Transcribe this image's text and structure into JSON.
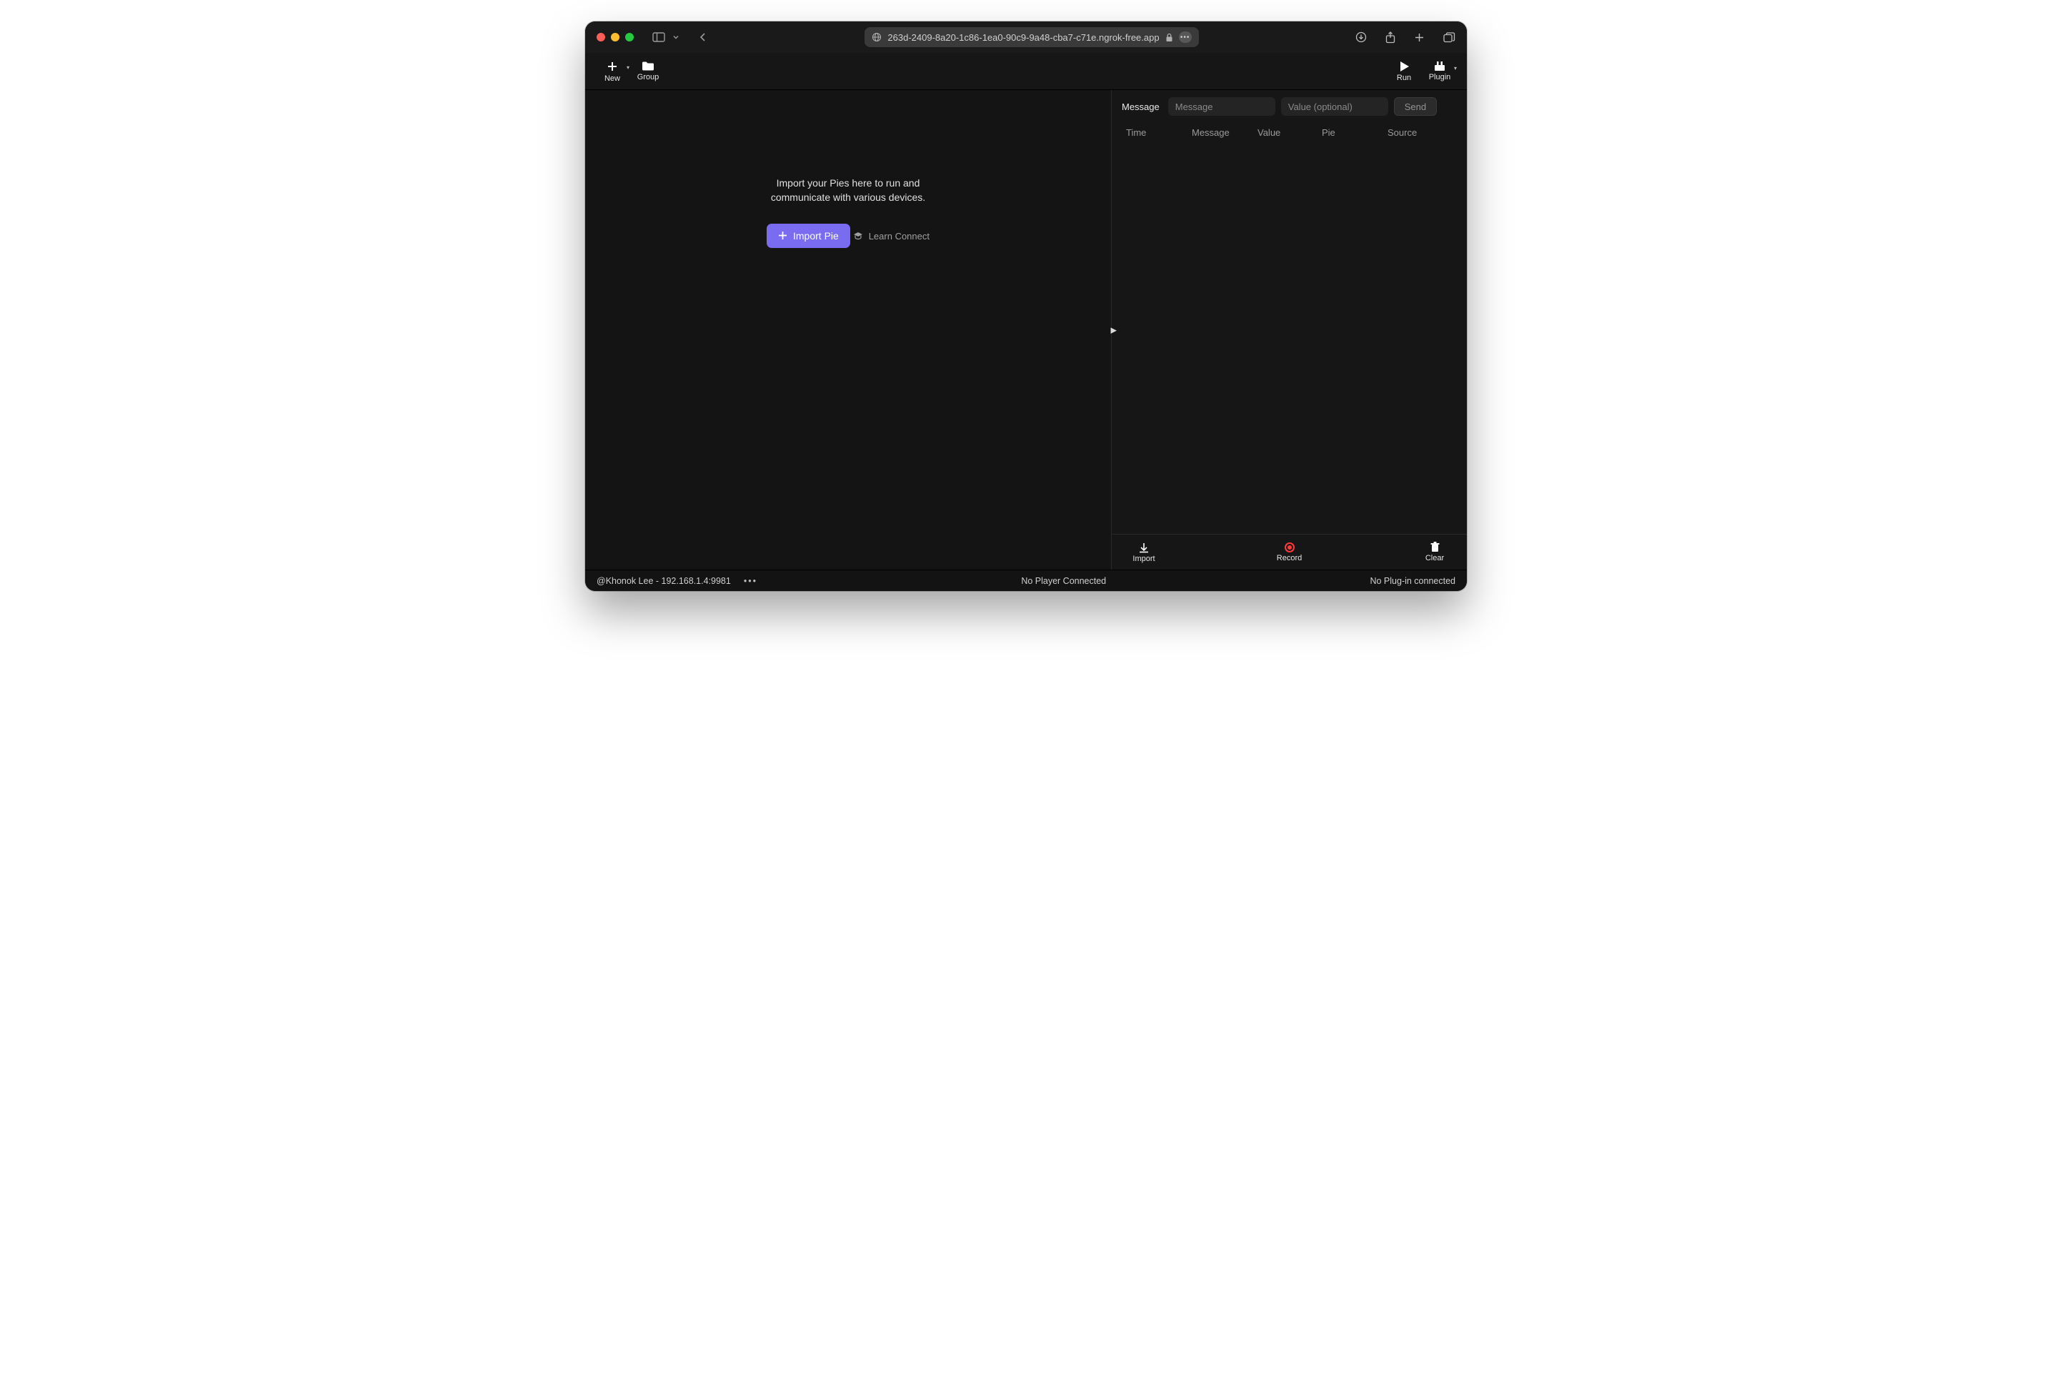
{
  "titlebar": {
    "url": "263d-2409-8a20-1c86-1ea0-90c9-9a48-cba7-c71e.ngrok-free.app"
  },
  "toolbar": {
    "new_label": "New",
    "group_label": "Group",
    "run_label": "Run",
    "plugin_label": "Plugin"
  },
  "empty_state": {
    "text": "Import your Pies here to run and communicate with various devices.",
    "import_label": "Import Pie",
    "learn_label": "Learn Connect"
  },
  "message_panel": {
    "label": "Message",
    "message_placeholder": "Message",
    "value_placeholder": "Value (optional)",
    "send_label": "Send",
    "headers": {
      "time": "Time",
      "message": "Message",
      "value": "Value",
      "pie": "Pie",
      "source": "Source"
    },
    "actions": {
      "import": "Import",
      "record": "Record",
      "clear": "Clear"
    }
  },
  "statusbar": {
    "user_host": "@Khonok Lee - 192.168.1.4:9981",
    "player_status": "No Player Connected",
    "plugin_status": "No Plug-in connected"
  }
}
